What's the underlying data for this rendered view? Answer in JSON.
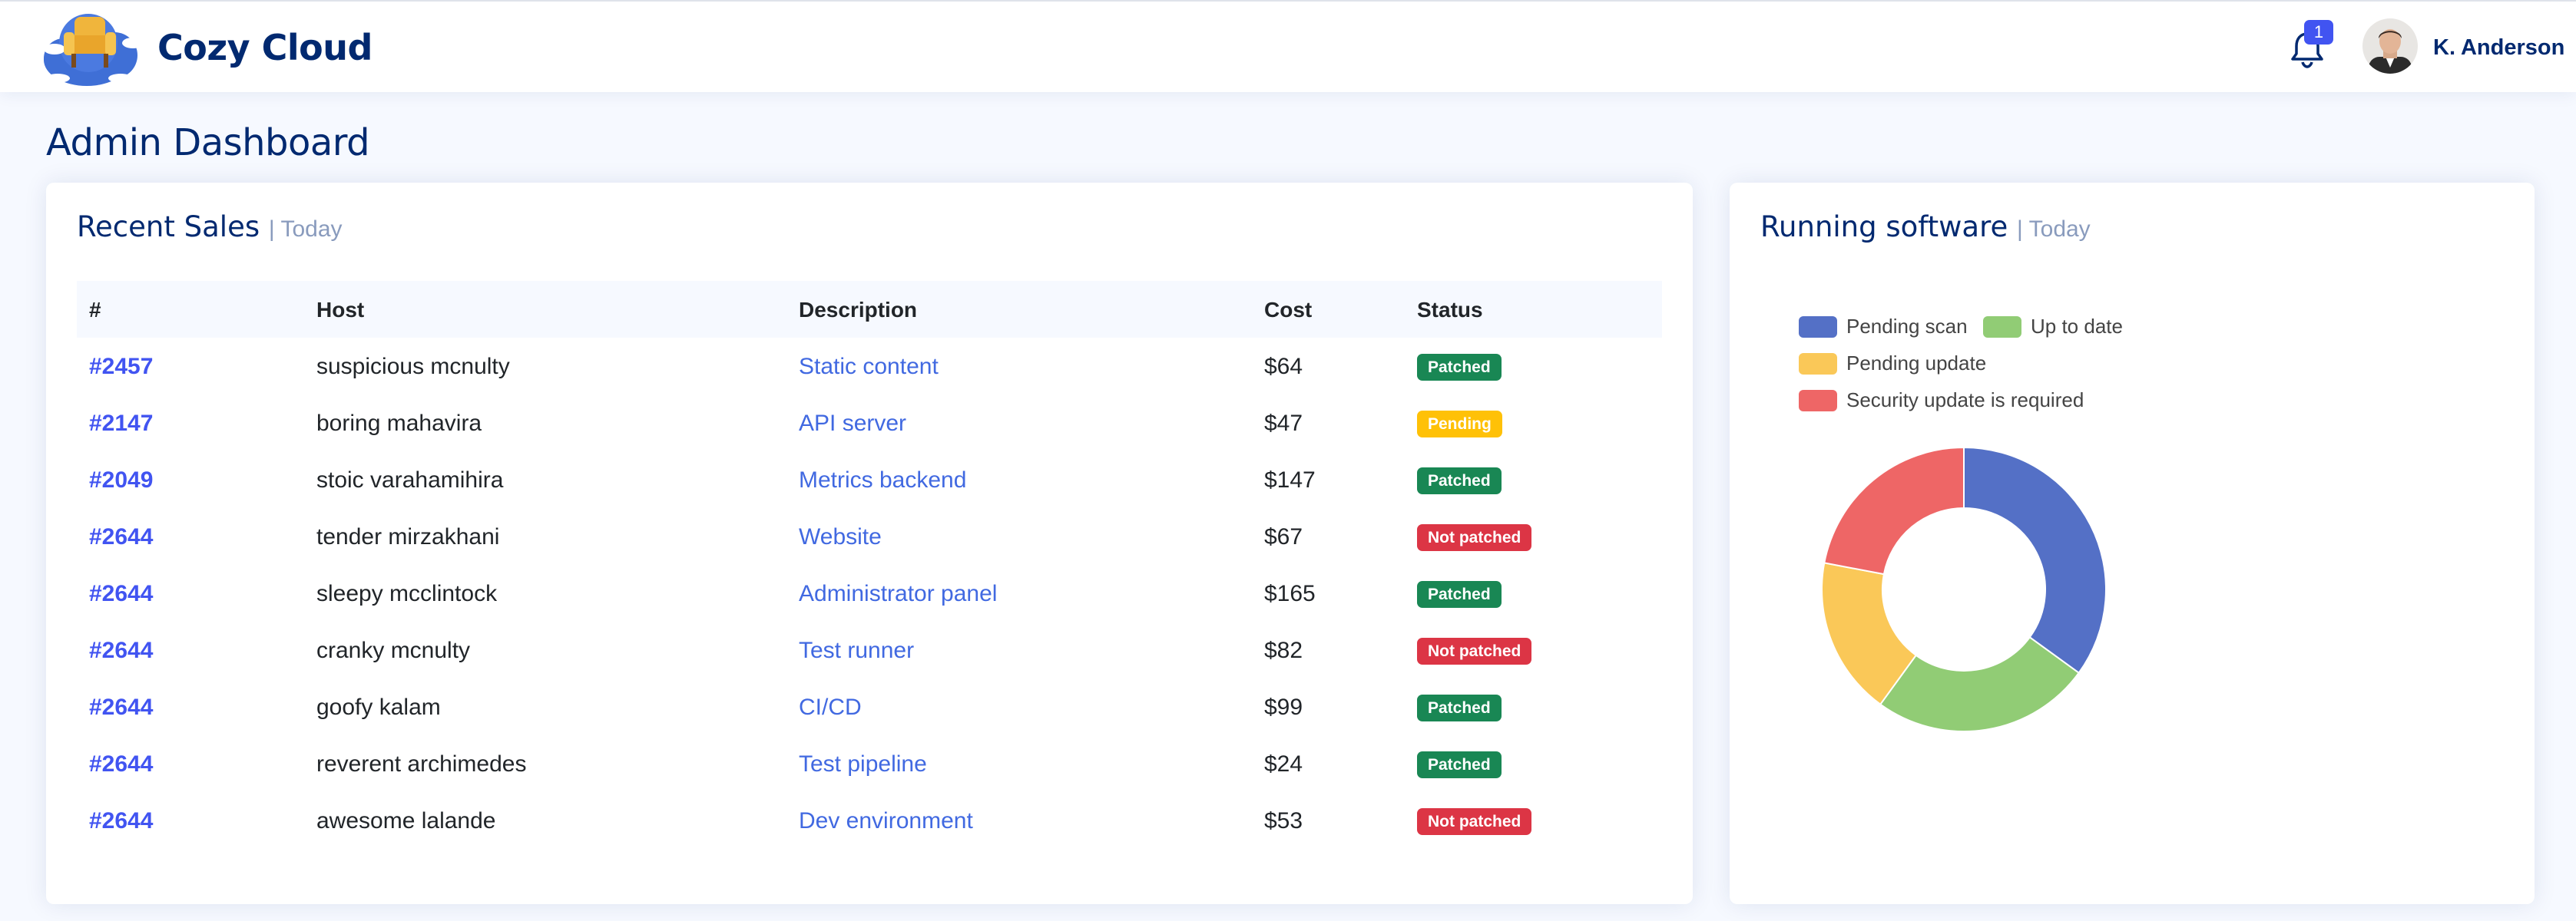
{
  "app": {
    "name": "Cozy Cloud"
  },
  "header": {
    "notifications_count": "1",
    "user_name": "K. Anderson"
  },
  "page": {
    "title": "Admin Dashboard"
  },
  "recent_sales": {
    "title": "Recent Sales",
    "period": "| Today",
    "columns": [
      "#",
      "Host",
      "Description",
      "Cost",
      "Status"
    ],
    "rows": [
      {
        "id": "#2457",
        "host": "suspicious mcnulty",
        "description": "Static content",
        "cost": "$64",
        "status": "Patched",
        "status_type": "patched"
      },
      {
        "id": "#2147",
        "host": "boring mahavira",
        "description": "API server",
        "cost": "$47",
        "status": "Pending",
        "status_type": "pending"
      },
      {
        "id": "#2049",
        "host": "stoic varahamihira",
        "description": "Metrics backend",
        "cost": "$147",
        "status": "Patched",
        "status_type": "patched"
      },
      {
        "id": "#2644",
        "host": "tender mirzakhani",
        "description": "Website",
        "cost": "$67",
        "status": "Not patched",
        "status_type": "notpatched"
      },
      {
        "id": "#2644",
        "host": "sleepy mcclintock",
        "description": "Administrator panel",
        "cost": "$165",
        "status": "Patched",
        "status_type": "patched"
      },
      {
        "id": "#2644",
        "host": "cranky mcnulty",
        "description": "Test runner",
        "cost": "$82",
        "status": "Not patched",
        "status_type": "notpatched"
      },
      {
        "id": "#2644",
        "host": "goofy kalam",
        "description": "CI/CD",
        "cost": "$99",
        "status": "Patched",
        "status_type": "patched"
      },
      {
        "id": "#2644",
        "host": "reverent archimedes",
        "description": "Test pipeline",
        "cost": "$24",
        "status": "Patched",
        "status_type": "patched"
      },
      {
        "id": "#2644",
        "host": "awesome lalande",
        "description": "Dev environment",
        "cost": "$53",
        "status": "Not patched",
        "status_type": "notpatched"
      }
    ]
  },
  "running_software": {
    "title": "Running software",
    "period": "| Today"
  },
  "chart_data": {
    "type": "pie",
    "donut": true,
    "categories": [
      "Pending scan",
      "Up to date",
      "Pending update",
      "Security update is required"
    ],
    "values": [
      35,
      25,
      18,
      22
    ],
    "colors": [
      "#5470c6",
      "#91cc75",
      "#fac858",
      "#ee6666"
    ],
    "legend_position": "top"
  }
}
